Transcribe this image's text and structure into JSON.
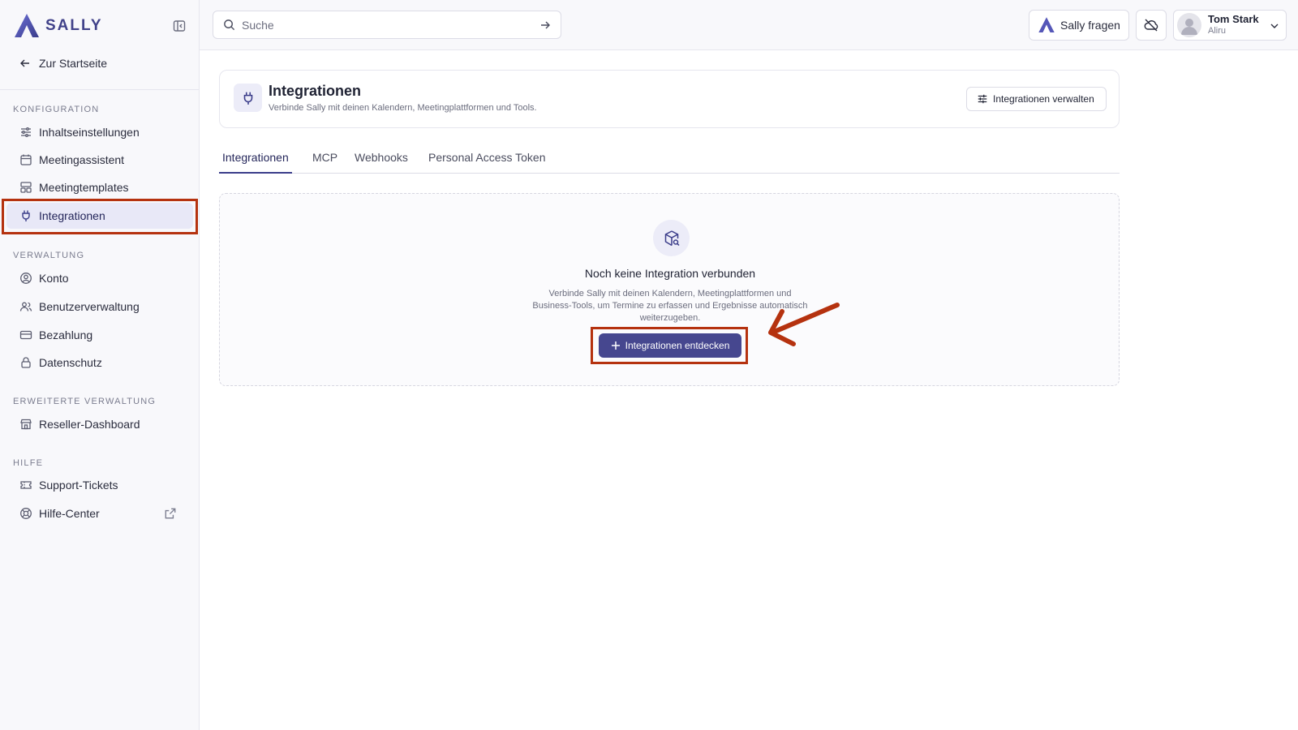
{
  "brand": {
    "name": "SALLY",
    "accent": "#46478f",
    "highlight": "#b5320f"
  },
  "sidebar": {
    "back_label": "Zur Startseite",
    "sections": [
      {
        "title": "KONFIGURATION",
        "items": [
          {
            "label": "Inhaltseinstellungen",
            "icon": "sliders-icon"
          },
          {
            "label": "Meetingassistent",
            "icon": "calendar-icon"
          },
          {
            "label": "Meetingtemplates",
            "icon": "template-icon"
          },
          {
            "label": "Integrationen",
            "icon": "plug-icon",
            "active": true
          }
        ]
      },
      {
        "title": "VERWALTUNG",
        "items": [
          {
            "label": "Konto",
            "icon": "user-circle-icon"
          },
          {
            "label": "Benutzerverwaltung",
            "icon": "users-icon"
          },
          {
            "label": "Bezahlung",
            "icon": "credit-card-icon"
          },
          {
            "label": "Datenschutz",
            "icon": "lock-icon"
          }
        ]
      },
      {
        "title": "ERWEITERTE VERWALTUNG",
        "items": [
          {
            "label": "Reseller-Dashboard",
            "icon": "store-icon"
          }
        ]
      },
      {
        "title": "HILFE",
        "items": [
          {
            "label": "Support-Tickets",
            "icon": "ticket-icon"
          },
          {
            "label": "Hilfe-Center",
            "icon": "lifebuoy-icon",
            "external": true
          }
        ]
      }
    ]
  },
  "topbar": {
    "search_placeholder": "Suche",
    "ask_sally_label": "Sally fragen",
    "user": {
      "name": "Tom Stark",
      "org": "Aliru"
    }
  },
  "header": {
    "title": "Integrationen",
    "subtitle": "Verbinde Sally mit deinen Kalendern, Meetingplattformen und Tools.",
    "manage_label": "Integrationen verwalten"
  },
  "tabs": [
    {
      "label": "Integrationen",
      "active": true
    },
    {
      "label": "MCP"
    },
    {
      "label": "Webhooks"
    },
    {
      "label": "Personal Access Token"
    }
  ],
  "empty_state": {
    "title": "Noch keine Integration verbunden",
    "description_lines": [
      "Verbinde Sally mit deinen Kalendern, Meetingplattformen und",
      "Business-Tools, um Termine zu erfassen und Ergebnisse automatisch",
      "weiterzugeben."
    ],
    "cta_label": "Integrationen entdecken"
  }
}
